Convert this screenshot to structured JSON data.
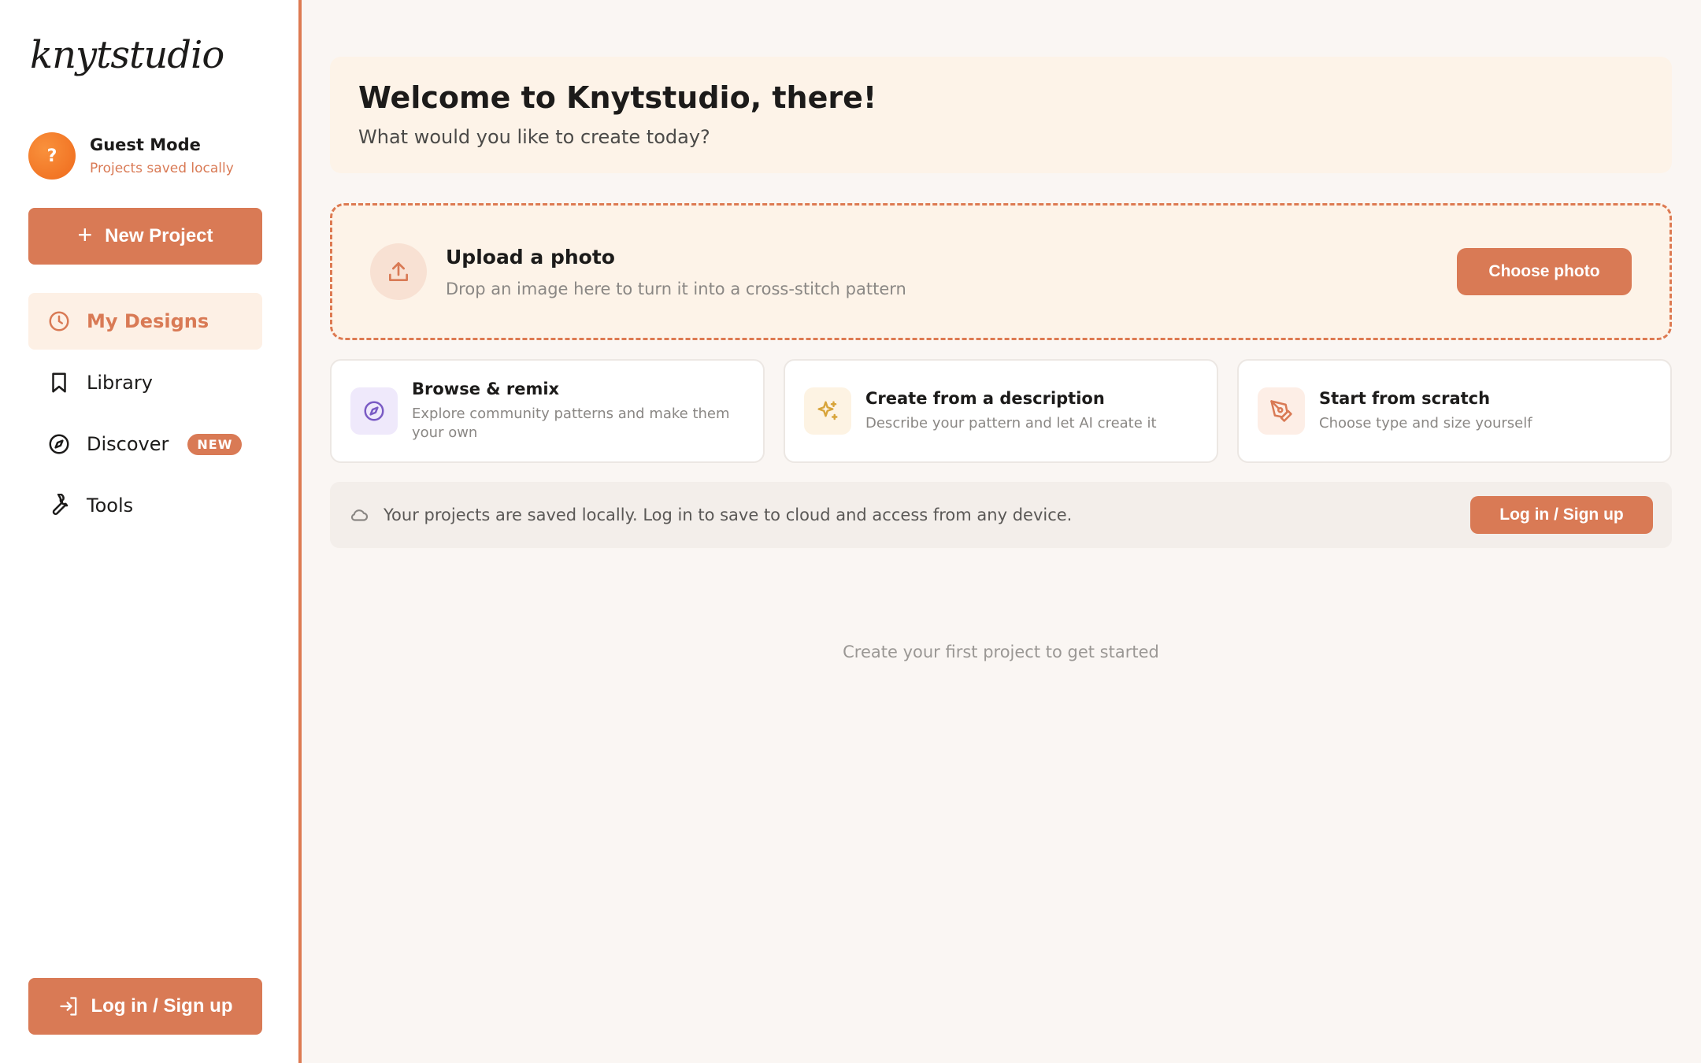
{
  "app": {
    "logo": "knytstudio"
  },
  "user": {
    "avatar_glyph": "?",
    "name": "Guest Mode",
    "status": "Projects saved locally"
  },
  "sidebar": {
    "new_project_label": "New Project",
    "nav": [
      {
        "label": "My Designs",
        "icon": "clock-icon",
        "active": true
      },
      {
        "label": "Library",
        "icon": "bookmark-icon"
      },
      {
        "label": "Discover",
        "icon": "compass-icon",
        "badge": "NEW"
      },
      {
        "label": "Tools",
        "icon": "wrench-icon"
      }
    ],
    "login_label": "Log in / Sign up"
  },
  "welcome": {
    "title": "Welcome to Knytstudio, there!",
    "subtitle": "What would you like to create today?"
  },
  "upload": {
    "title": "Upload a photo",
    "subtitle": "Drop an image here to turn it into a cross-stitch pattern",
    "button": "Choose photo",
    "icon": "upload-icon"
  },
  "cards": [
    {
      "title": "Browse & remix",
      "subtitle": "Explore community patterns and make them your own",
      "icon": "compass-icon",
      "icon_bg": "#efe9fb",
      "icon_color": "#7a5bc4"
    },
    {
      "title": "Create from a description",
      "subtitle": "Describe your pattern and let AI create it",
      "icon": "sparkles-icon",
      "icon_bg": "#fdf3e3",
      "icon_color": "#d8a43a"
    },
    {
      "title": "Start from scratch",
      "subtitle": "Choose type and size yourself",
      "icon": "pen-icon",
      "icon_bg": "#fdeee6",
      "icon_color": "#d97a55"
    }
  ],
  "cloud_notice": {
    "text": "Your projects are saved locally. Log in to save to cloud and access from any device.",
    "button": "Log in / Sign up",
    "icon": "cloud-icon"
  },
  "empty_state": "Create your first project to get started",
  "colors": {
    "accent": "#d97a55",
    "sidebar_border": "#dd7a52",
    "background": "#faf6f3",
    "panel": "#fdf3e8"
  }
}
